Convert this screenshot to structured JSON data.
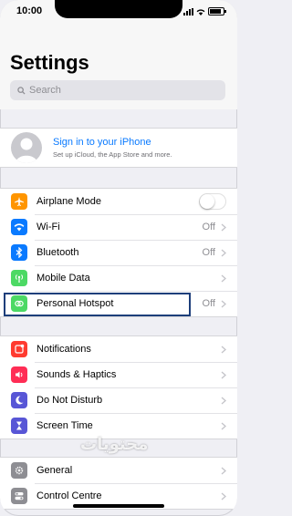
{
  "status_bar": {
    "time": "10:00"
  },
  "header": {
    "title": "Settings",
    "search_placeholder": "Search"
  },
  "profile": {
    "title": "Sign in to your iPhone",
    "subtitle": "Set up iCloud, the App Store and more."
  },
  "connectivity": [
    {
      "label": "Airplane Mode",
      "icon": "airplane-icon",
      "color": "#ff9500",
      "control": "toggle",
      "on": false
    },
    {
      "label": "Wi-Fi",
      "icon": "wifi-icon",
      "color": "#0a7aff",
      "value": "Off"
    },
    {
      "label": "Bluetooth",
      "icon": "bluetooth-icon",
      "color": "#0a7aff",
      "value": "Off"
    },
    {
      "label": "Mobile Data",
      "icon": "antenna-icon",
      "color": "#4cd964",
      "value": ""
    },
    {
      "label": "Personal Hotspot",
      "icon": "hotspot-icon",
      "color": "#4cd964",
      "value": "Off"
    }
  ],
  "notifications": [
    {
      "label": "Notifications",
      "icon": "notifications-icon",
      "color": "#ff3b30"
    },
    {
      "label": "Sounds & Haptics",
      "icon": "speaker-icon",
      "color": "#ff2d55"
    },
    {
      "label": "Do Not Disturb",
      "icon": "moon-icon",
      "color": "#5856d6"
    },
    {
      "label": "Screen Time",
      "icon": "hourglass-icon",
      "color": "#5856d6"
    }
  ],
  "general": [
    {
      "label": "General",
      "icon": "gear-icon",
      "color": "#8e8e93"
    },
    {
      "label": "Control Centre",
      "icon": "switches-icon",
      "color": "#8e8e93"
    }
  ],
  "watermark": "محتويات"
}
